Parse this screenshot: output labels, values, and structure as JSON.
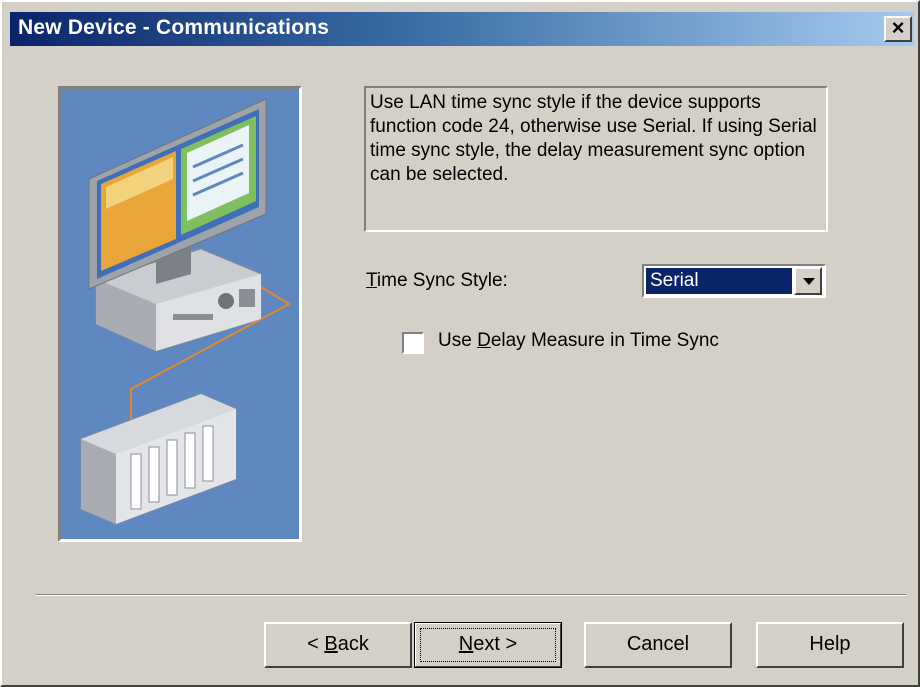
{
  "window": {
    "title": "New Device - Communications",
    "close_glyph": "×"
  },
  "illustration": {
    "icon": "pc-to-plc-network-illustration"
  },
  "info": {
    "text": "Use LAN time sync style if the device supports function code 24, otherwise use Serial. If using Serial time sync style, the delay measurement sync option can be selected."
  },
  "time_sync": {
    "label_mnemonic": "T",
    "label_rest": "ime Sync Style:",
    "selected": "Serial"
  },
  "delay_measure": {
    "label_pre": "Use ",
    "label_mnemonic": "D",
    "label_post": "elay Measure in Time Sync",
    "checked": false
  },
  "buttons": {
    "back_arrow": "< ",
    "back_mnemonic": "B",
    "back_rest": "ack",
    "next_mnemonic": "N",
    "next_rest": "ext",
    "next_arrow": " >",
    "cancel": "Cancel",
    "help": "Help"
  },
  "colors": {
    "window_bg": "#d4d0c8",
    "titlebar_start": "#0a246a",
    "titlebar_end": "#a6caf0",
    "selection": "#0a246a",
    "illustration_bg": "#5f88c0"
  }
}
